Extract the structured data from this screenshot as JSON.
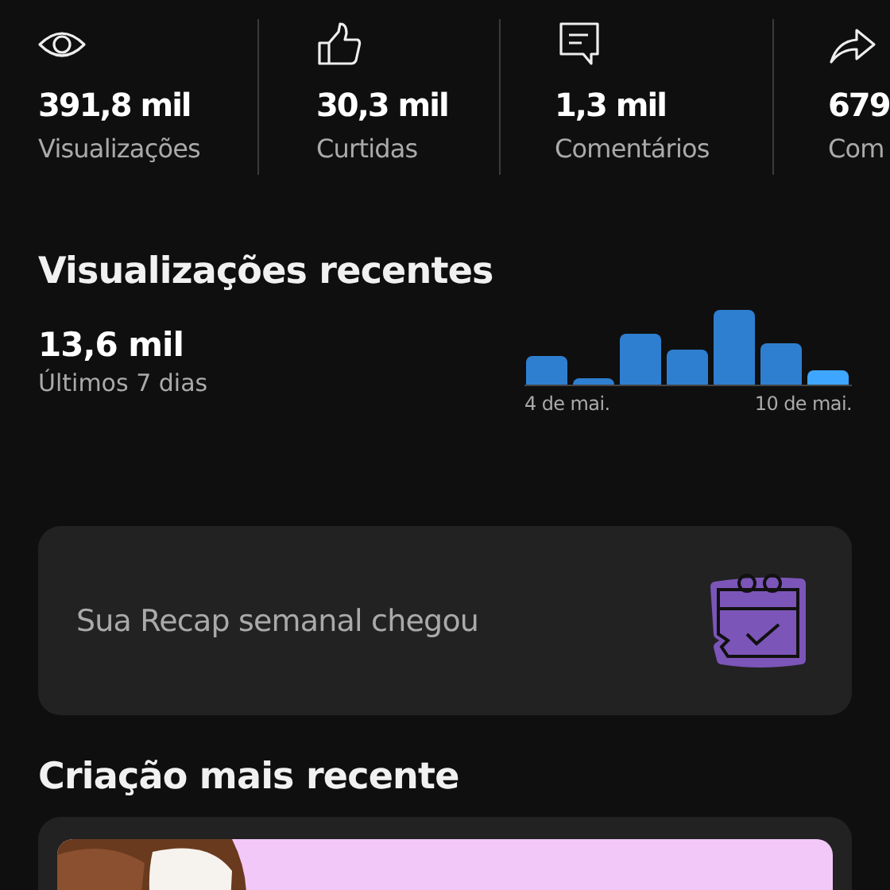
{
  "stats": [
    {
      "kind": "views",
      "value": "391,8 mil",
      "label": "Visualizações"
    },
    {
      "kind": "likes",
      "value": "30,3 mil",
      "label": "Curtidas"
    },
    {
      "kind": "comments",
      "value": "1,3 mil",
      "label": "Comentários"
    },
    {
      "kind": "shares",
      "value": "679",
      "label": "Com"
    }
  ],
  "recent_views": {
    "title": "Visualizações recentes",
    "total": "13,6 mil",
    "period": "Últimos 7 dias",
    "axis_start": "4 de mai.",
    "axis_end": "10 de mai."
  },
  "recap_card": {
    "text": "Sua Recap semanal chegou"
  },
  "latest_creation": {
    "title": "Criação mais recente"
  }
}
